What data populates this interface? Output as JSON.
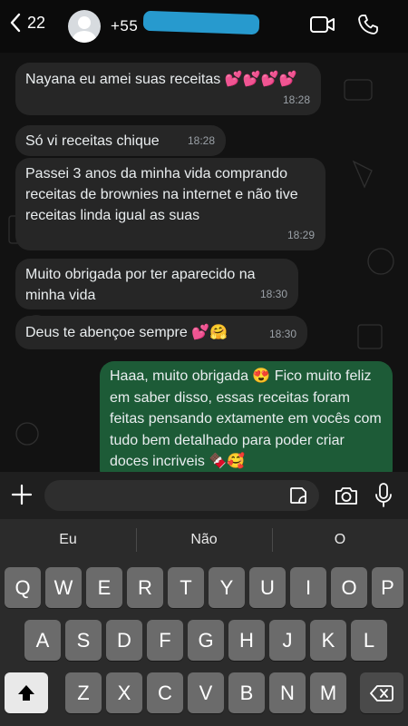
{
  "header": {
    "back_count": "22",
    "contact_visible": "+55"
  },
  "messages": [
    {
      "dir": "in",
      "text": "Nayana eu amei suas receitas 💕💕💕💕",
      "time": "18:28"
    },
    {
      "dir": "in",
      "text": "Só vi receitas chique",
      "time": "18:28"
    },
    {
      "dir": "in",
      "text": "Passei 3 anos da minha vida comprando receitas de brownies na internet e não tive receitas linda igual as suas",
      "time": "18:29"
    },
    {
      "dir": "in",
      "text": "Muito obrigada por ter aparecido na minha vida",
      "time": "18:30"
    },
    {
      "dir": "in",
      "text": "Deus te abençoe sempre 💕🤗",
      "time": "18:30"
    },
    {
      "dir": "out",
      "text": "Haaa, muito obrigada 😍 Fico muito feliz em saber disso, essas receitas foram feitas pensando extamente em vocês com tudo bem detalhado para poder criar doces incriveis 🍫🥰",
      "time": ""
    }
  ],
  "suggestions": [
    "Eu",
    "Não",
    "O"
  ],
  "keys": {
    "row1": [
      "Q",
      "W",
      "E",
      "R",
      "T",
      "Y",
      "U",
      "I",
      "O",
      "P"
    ],
    "row2": [
      "A",
      "S",
      "D",
      "F",
      "G",
      "H",
      "J",
      "K",
      "L"
    ],
    "row3": [
      "Z",
      "X",
      "C",
      "V",
      "B",
      "N",
      "M"
    ]
  },
  "icons": [
    "back-chevron-icon",
    "avatar-icon",
    "video-call-icon",
    "phone-icon",
    "plus-icon",
    "sticker-icon",
    "camera-icon",
    "microphone-icon",
    "shift-icon",
    "backspace-icon"
  ],
  "colors": {
    "incoming_bubble": "#262626",
    "outgoing_bubble": "#1d5b37",
    "background": "#121212"
  }
}
